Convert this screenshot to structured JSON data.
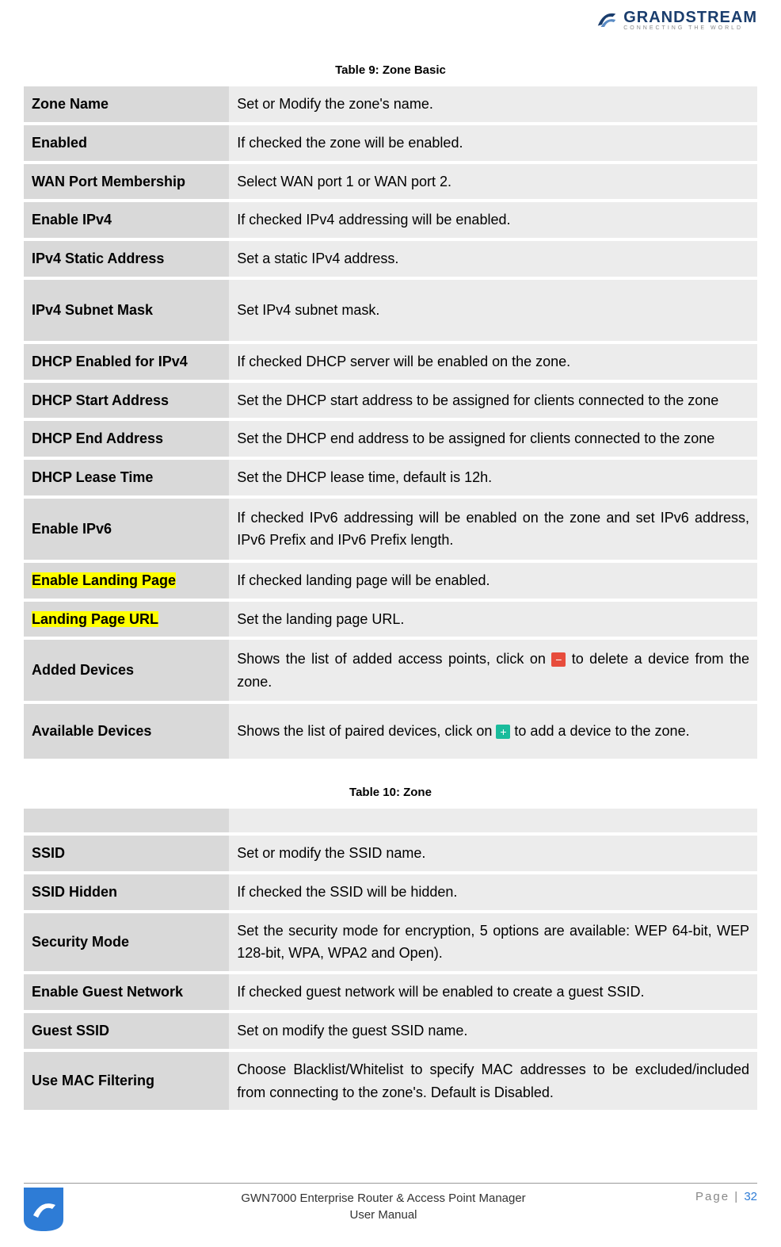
{
  "logo": {
    "brand": "GRANDSTREAM",
    "tagline": "CONNECTING THE WORLD"
  },
  "table9": {
    "caption": "Table 9: Zone Basic",
    "rows": [
      {
        "label": "Zone Name",
        "desc": "Set or Modify the zone's name."
      },
      {
        "label": "Enabled",
        "desc": "If checked the zone will be enabled."
      },
      {
        "label": "WAN Port Membership",
        "desc": "Select WAN port 1 or WAN port 2."
      },
      {
        "label": "Enable IPv4",
        "desc": "If checked IPv4 addressing will be enabled."
      },
      {
        "label": "IPv4 Static Address",
        "desc": "Set a static IPv4 address."
      },
      {
        "label": "IPv4 Subnet Mask",
        "desc": "Set IPv4 subnet mask.",
        "tall": true
      },
      {
        "label": "DHCP Enabled for IPv4",
        "desc": "If checked DHCP server will be enabled on the zone."
      },
      {
        "label": "DHCP Start Address",
        "desc": "Set the DHCP start address to be assigned for clients connected to the zone"
      },
      {
        "label": "DHCP End Address",
        "desc": "Set the DHCP end address to be assigned for clients connected to the zone"
      },
      {
        "label": "DHCP Lease Time",
        "desc": "Set the DHCP lease time, default is 12h."
      },
      {
        "label": "Enable IPv6",
        "desc": "If checked IPv6 addressing will be enabled on the zone and set IPv6 address, IPv6 Prefix and IPv6 Prefix length.",
        "tall": true
      },
      {
        "label": "Enable Landing Page",
        "desc": "If checked landing page will be enabled.",
        "highlight": true
      },
      {
        "label": "Landing Page URL",
        "desc": "Set the landing page URL.",
        "highlight": true
      }
    ],
    "addedDevices": {
      "label": "Added Devices",
      "pre": "Shows the list of added access points, click on ",
      "post": " to delete a device from the zone."
    },
    "availableDevices": {
      "label": "Available Devices",
      "pre": "Shows the list of paired devices, click on ",
      "post": " to add a device to the zone."
    }
  },
  "table10": {
    "caption": "Table 10: Zone",
    "rows": [
      {
        "label": "SSID",
        "desc": "Set or modify the SSID name."
      },
      {
        "label": "SSID Hidden",
        "desc": "If checked the SSID will be hidden."
      },
      {
        "label": "Security Mode",
        "desc": "Set the security mode for encryption, 5 options are available: WEP 64-bit, WEP 128-bit, WPA, WPA2 and Open)."
      },
      {
        "label": "Enable Guest Network",
        "desc": "If checked guest network will be enabled to create a guest SSID."
      },
      {
        "label": "Guest SSID",
        "desc": "Set on modify the guest SSID name."
      },
      {
        "label": "Use MAC Filtering",
        "desc": "Choose Blacklist/Whitelist to specify MAC addresses to be excluded/included from connecting to the zone's. Default is Disabled.",
        "tall": true
      }
    ]
  },
  "footer": {
    "title": "GWN7000 Enterprise Router & Access Point Manager",
    "subtitle": "User Manual",
    "pageLabel": "Page |",
    "pageNumber": "32"
  }
}
